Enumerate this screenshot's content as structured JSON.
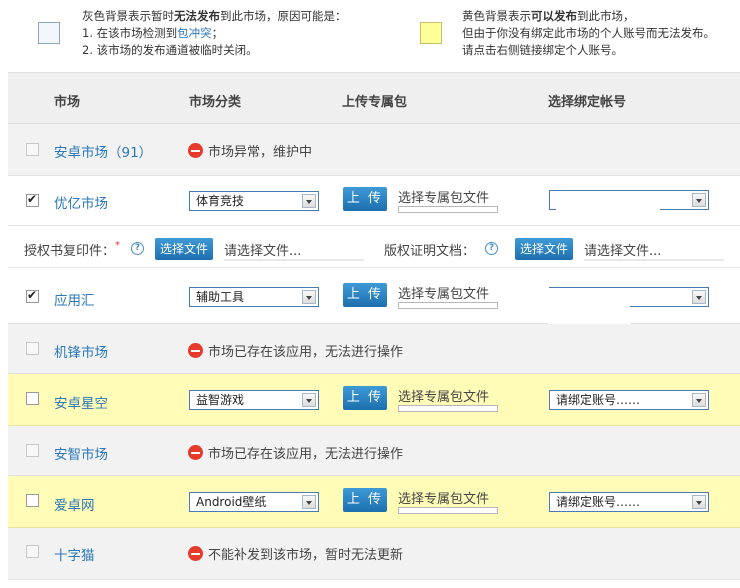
{
  "legend": {
    "gray": {
      "line1_pre": "灰色背景表示暂时",
      "line1_bold": "无法发布",
      "line1_post": "到此市场，原因可能是：",
      "line2_pre": "1. 在该市场检测到",
      "line2_link": "包冲突",
      "line2_post": "；",
      "line3": "2. 该市场的发布通道被临时关闭。"
    },
    "yellow": {
      "line1_pre": "黄色背景表示",
      "line1_bold": "可以发布",
      "line1_post": "到此市场，",
      "line2": "但由于你没有绑定此市场的个人账号而无法发布。",
      "line3": "请点击右侧链接绑定个人账号。"
    }
  },
  "header": {
    "market": "市场",
    "category": "市场分类",
    "upload_pkg": "上传专属包",
    "account": "选择绑定帐号"
  },
  "upload_label": "上 传",
  "pkg_label": "选择专属包文件",
  "account_placeholder": "请绑定账号……",
  "rows": [
    {
      "name": "安卓市场（91）",
      "status": "市场异常，维护中"
    },
    {
      "name": "优亿市场",
      "category": "体育竞技"
    },
    {
      "name": "应用汇",
      "category": "辅助工具"
    },
    {
      "name": "机锋市场",
      "status": "市场已存在该应用，无法进行操作"
    },
    {
      "name": "安卓星空",
      "category": "益智游戏"
    },
    {
      "name": "安智市场",
      "status": "市场已存在该应用，无法进行操作"
    },
    {
      "name": "爱卓网",
      "category": "Android壁纸"
    },
    {
      "name": "十字猫",
      "status": "不能补发到该市场，暂时无法更新"
    }
  ],
  "auth": {
    "license_label": "授权书复印件：",
    "required_mark": "*",
    "choose_label": "选择文件",
    "file_hint": "请选择文件...",
    "copyright_label": "版权证明文档："
  }
}
